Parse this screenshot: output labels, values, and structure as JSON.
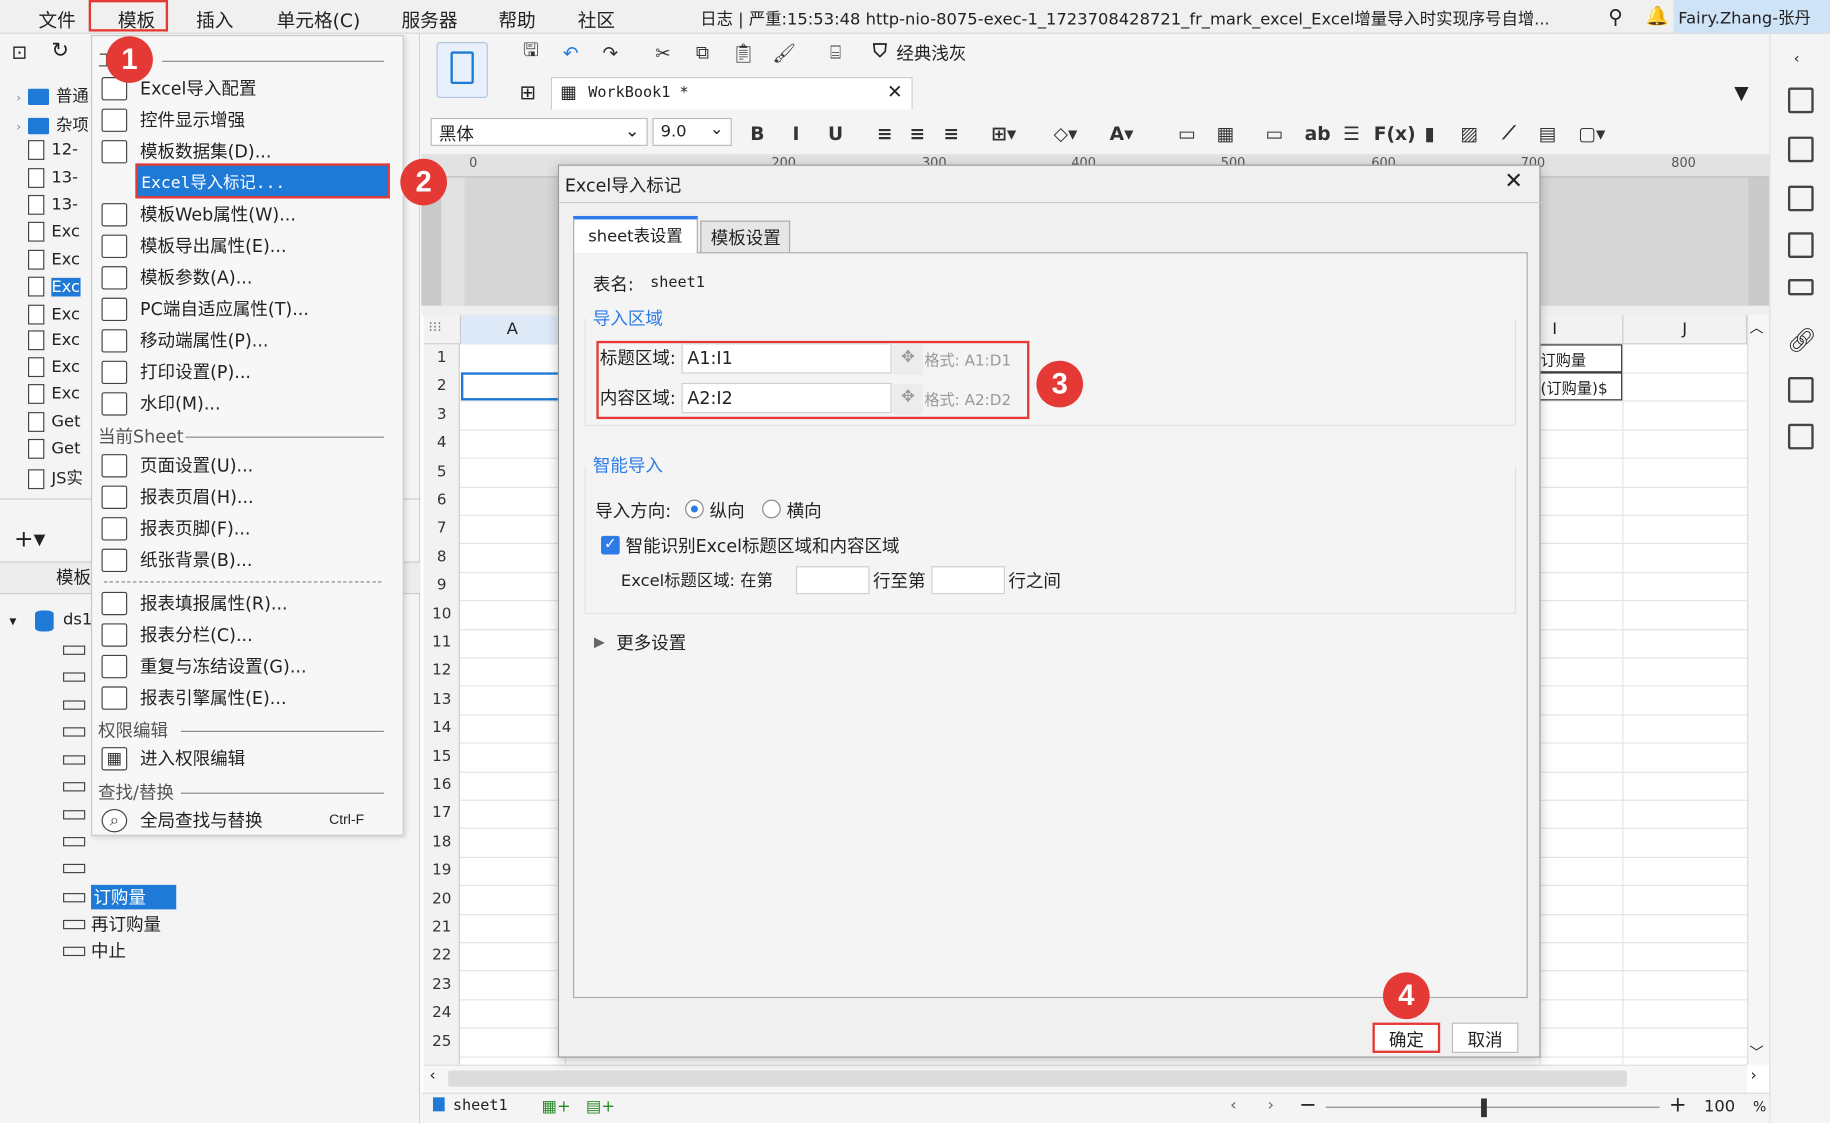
{
  "menubar": {
    "items": [
      "文件",
      "模板",
      "插入",
      "单元格(C)",
      "服务器",
      "帮助",
      "社区"
    ],
    "log_text": "日志 | 严重:15:53:48 http-nio-8075-exec-1_1723708428721_fr_mark_excel_Excel增量导入时实现序号自增...",
    "user": "Fairy.Zhang-张丹"
  },
  "left_tree": {
    "top_items": [
      "普通",
      "杂项",
      "12-",
      "13-",
      "13-",
      "Exc",
      "Exc",
      "Exc",
      "Exc",
      "Exc",
      "Exc",
      "Exc",
      "Get",
      "Get",
      "JS实"
    ],
    "selected_index": 7,
    "panel2_label": "模板",
    "ds_name": "ds1",
    "fields": [
      "订购量",
      "再订购量",
      "中止"
    ],
    "selected_field": "订购量"
  },
  "dropdown": {
    "sec_template": "工",
    "items_a": [
      {
        "label": "Excel导入配置",
        "icon": "excel-config-icon"
      },
      {
        "label": "控件显示增强",
        "icon": "widget-display-icon"
      },
      {
        "label": "模板数据集(D)...",
        "icon": "database-icon"
      },
      {
        "label": "Excel导入标记...",
        "icon": "excel-import-mark-icon"
      },
      {
        "label": "模板Web属性(W)...",
        "icon": "globe-icon"
      },
      {
        "label": "模板导出属性(E)...",
        "icon": "export-icon"
      },
      {
        "label": "模板参数(A)...",
        "icon": "parameter-icon"
      },
      {
        "label": "PC端自适应属性(T)...",
        "icon": "adaptive-icon"
      },
      {
        "label": "移动端属性(P)...",
        "icon": "mobile-icon"
      },
      {
        "label": "打印设置(P)...",
        "icon": "printer-icon"
      },
      {
        "label": "水印(M)...",
        "icon": "watermark-icon"
      }
    ],
    "sec_sheet": "当前Sheet",
    "items_b": [
      {
        "label": "页面设置(U)...",
        "icon": "page-setup-icon"
      },
      {
        "label": "报表页眉(H)...",
        "icon": "header-icon"
      },
      {
        "label": "报表页脚(F)...",
        "icon": "footer-icon"
      },
      {
        "label": "纸张背景(B)...",
        "icon": "paper-background-icon"
      }
    ],
    "items_c": [
      {
        "label": "报表填报属性(R)...",
        "icon": "fill-property-icon"
      },
      {
        "label": "报表分栏(C)...",
        "icon": "columns-icon"
      },
      {
        "label": "重复与冻结设置(G)...",
        "icon": "freeze-icon"
      },
      {
        "label": "报表引擎属性(E)...",
        "icon": "engine-icon"
      }
    ],
    "sec_perm": "权限编辑",
    "perm_item": "进入权限编辑",
    "sec_find": "查找/替换",
    "find_item": "全局查找与替换",
    "find_shortcut": "Ctrl-F"
  },
  "editor": {
    "tab_label": "WorkBook1 *",
    "theme_label": "经典浅灰",
    "font_name": "黑体",
    "font_size": "9.0",
    "ruler_marks": [
      "0",
      "200",
      "300",
      "400",
      "500",
      "600",
      "700",
      "800"
    ],
    "col_a": "A",
    "col_i": "I",
    "col_j": "J",
    "cell_i1": "订购量",
    "cell_i2": "$(订购量)",
    "rows": [
      "1",
      "2",
      "3",
      "4",
      "5",
      "6",
      "7",
      "8",
      "9",
      "10",
      "11",
      "12",
      "13",
      "14",
      "15",
      "16",
      "17",
      "18",
      "19",
      "20",
      "21",
      "22",
      "23",
      "24",
      "25"
    ],
    "sheet_tab": "sheet1",
    "zoom": "100",
    "zoom_unit": "%"
  },
  "dialog": {
    "title": "Excel导入标记",
    "tabs": [
      "sheet表设置",
      "模板设置"
    ],
    "sheet_name_label": "表名:",
    "sheet_name_value": "sheet1",
    "import_area_title": "导入区域",
    "title_area_label": "标题区域:",
    "title_area_value": "A1:I1",
    "title_area_hint": "格式: A1:D1",
    "content_area_label": "内容区域:",
    "content_area_value": "A2:I2",
    "content_area_hint": "格式: A2:D2",
    "smart_title": "智能导入",
    "direction_label": "导入方向:",
    "direction_vertical": "纵向",
    "direction_horizontal": "横向",
    "smart_checkbox": "智能识别Excel标题区域和内容区域",
    "range_label": "Excel标题区域: 在第",
    "range_mid": "行至第",
    "range_end": "行之间",
    "more_settings": "更多设置",
    "ok": "确定",
    "cancel": "取消"
  },
  "badges": [
    "1",
    "2",
    "3",
    "4"
  ],
  "colors": {
    "accent_red": "#e53935",
    "selection_blue": "#1e7ad6",
    "link_blue": "#2d7be6"
  }
}
